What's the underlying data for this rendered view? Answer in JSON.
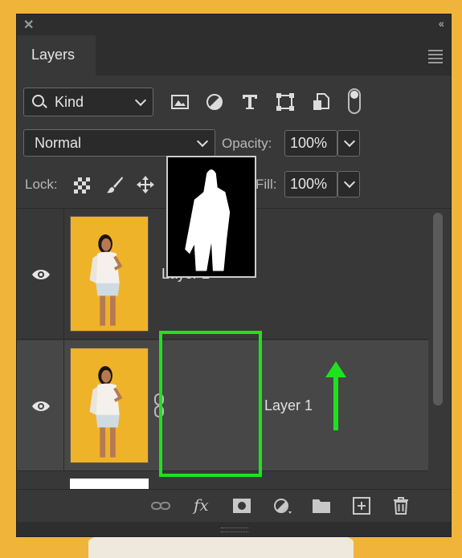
{
  "panel": {
    "title": "Layers",
    "filter": {
      "kind_label": "Kind"
    },
    "blend_mode": "Normal",
    "opacity": {
      "label": "Opacity:",
      "value": "100%"
    },
    "lock": {
      "label": "Lock:"
    },
    "fill": {
      "label": "Fill:",
      "value": "100%"
    }
  },
  "layers": [
    {
      "name": "Layer 2",
      "visible": true,
      "selected": false
    },
    {
      "name": "Layer 1",
      "visible": true,
      "selected": true,
      "has_mask": true
    }
  ],
  "annotation": {
    "highlight_color": "#1ee21e"
  },
  "icons": {
    "filter": [
      "image-filter-icon",
      "adjustment-filter-icon",
      "type-filter-icon",
      "shape-filter-icon",
      "smart-object-filter-icon"
    ],
    "lock": [
      "lock-transparent-pixels-icon",
      "lock-image-pixels-icon",
      "lock-position-icon",
      "lock-artboard-icon",
      "lock-all-icon"
    ],
    "bottom": [
      "link-layers-icon",
      "fx-icon",
      "add-mask-icon",
      "new-adjustment-icon",
      "new-group-icon",
      "new-layer-icon",
      "delete-layer-icon"
    ]
  },
  "colors": {
    "panel_bg": "#383838",
    "selected_row": "#474747",
    "canvas_bg": "#f0b43a"
  }
}
